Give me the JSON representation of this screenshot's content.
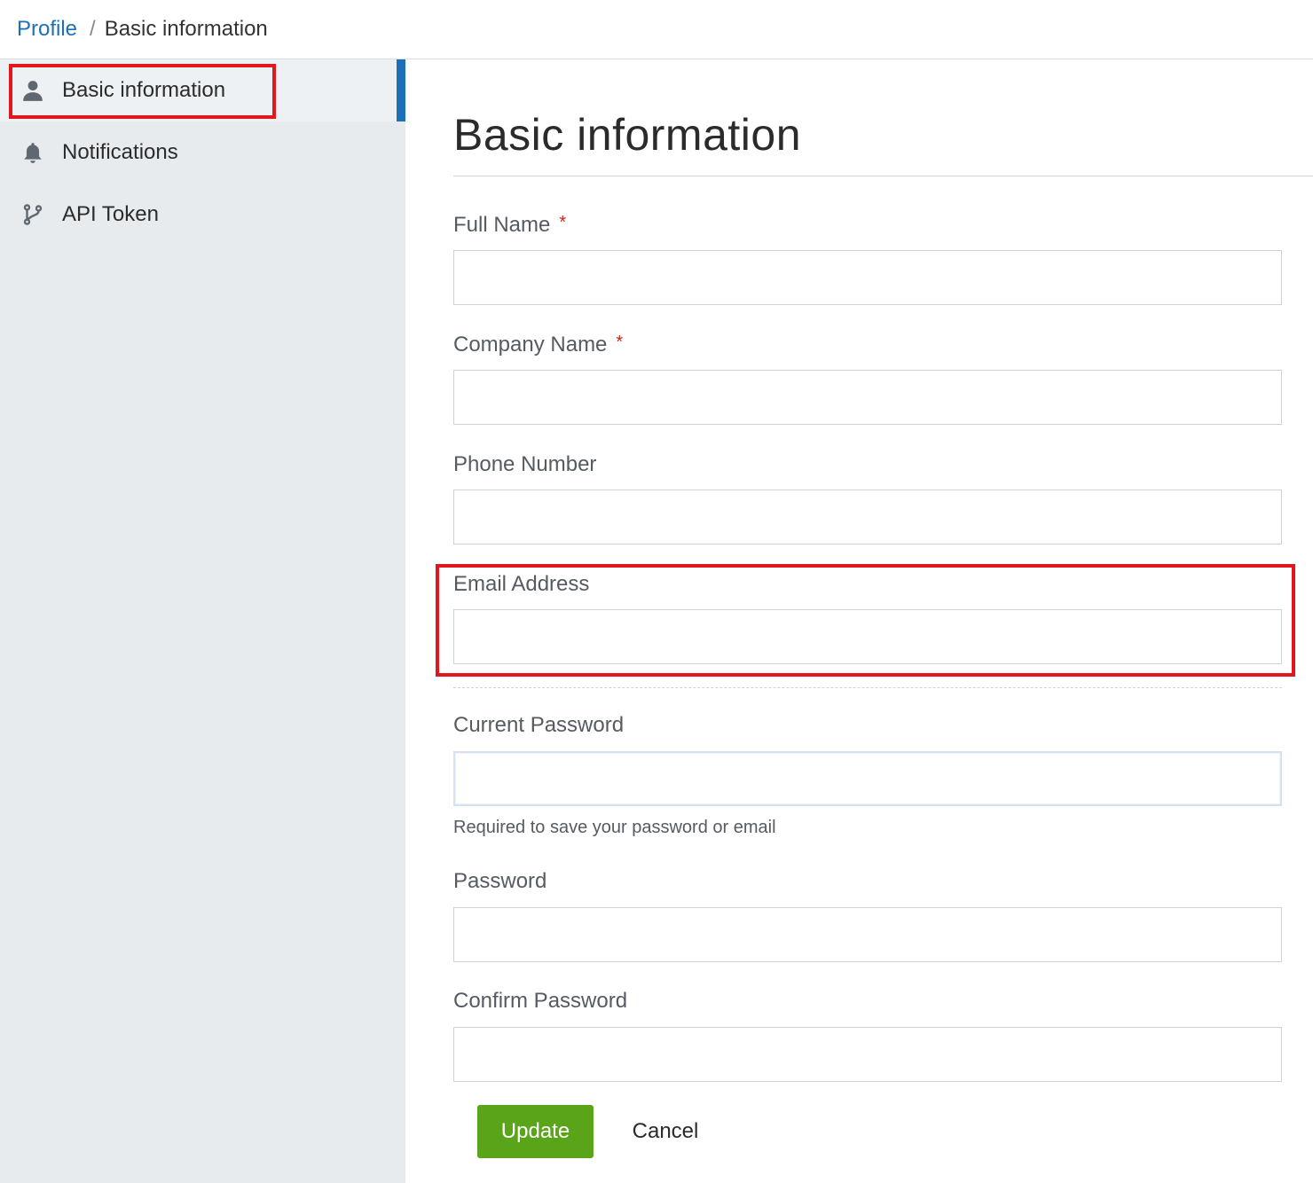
{
  "breadcrumb": {
    "link": "Profile",
    "separator": "/",
    "current": "Basic information"
  },
  "sidebar": {
    "items": [
      {
        "label": "Basic information",
        "icon": "user-icon",
        "active": true
      },
      {
        "label": "Notifications",
        "icon": "bell-icon",
        "active": false
      },
      {
        "label": "API Token",
        "icon": "branch-icon",
        "active": false
      }
    ]
  },
  "main": {
    "title": "Basic information",
    "required_marker": "*",
    "fields": {
      "full_name": {
        "label": "Full Name",
        "value": "",
        "required": true
      },
      "company_name": {
        "label": "Company Name",
        "value": "",
        "required": true
      },
      "phone_number": {
        "label": "Phone Number",
        "value": ""
      },
      "email_address": {
        "label": "Email Address",
        "value": ""
      },
      "current_password": {
        "label": "Current Password",
        "value": "",
        "helper": "Required to save your password or email"
      },
      "password": {
        "label": "Password",
        "value": ""
      },
      "confirm_password": {
        "label": "Confirm Password",
        "value": ""
      }
    },
    "actions": {
      "update": "Update",
      "cancel": "Cancel"
    }
  },
  "colors": {
    "accent": "#1d6fb8",
    "primary_button": "#5aa41a",
    "highlight": "#e3161d",
    "sidebar_bg": "#e8ebee"
  }
}
